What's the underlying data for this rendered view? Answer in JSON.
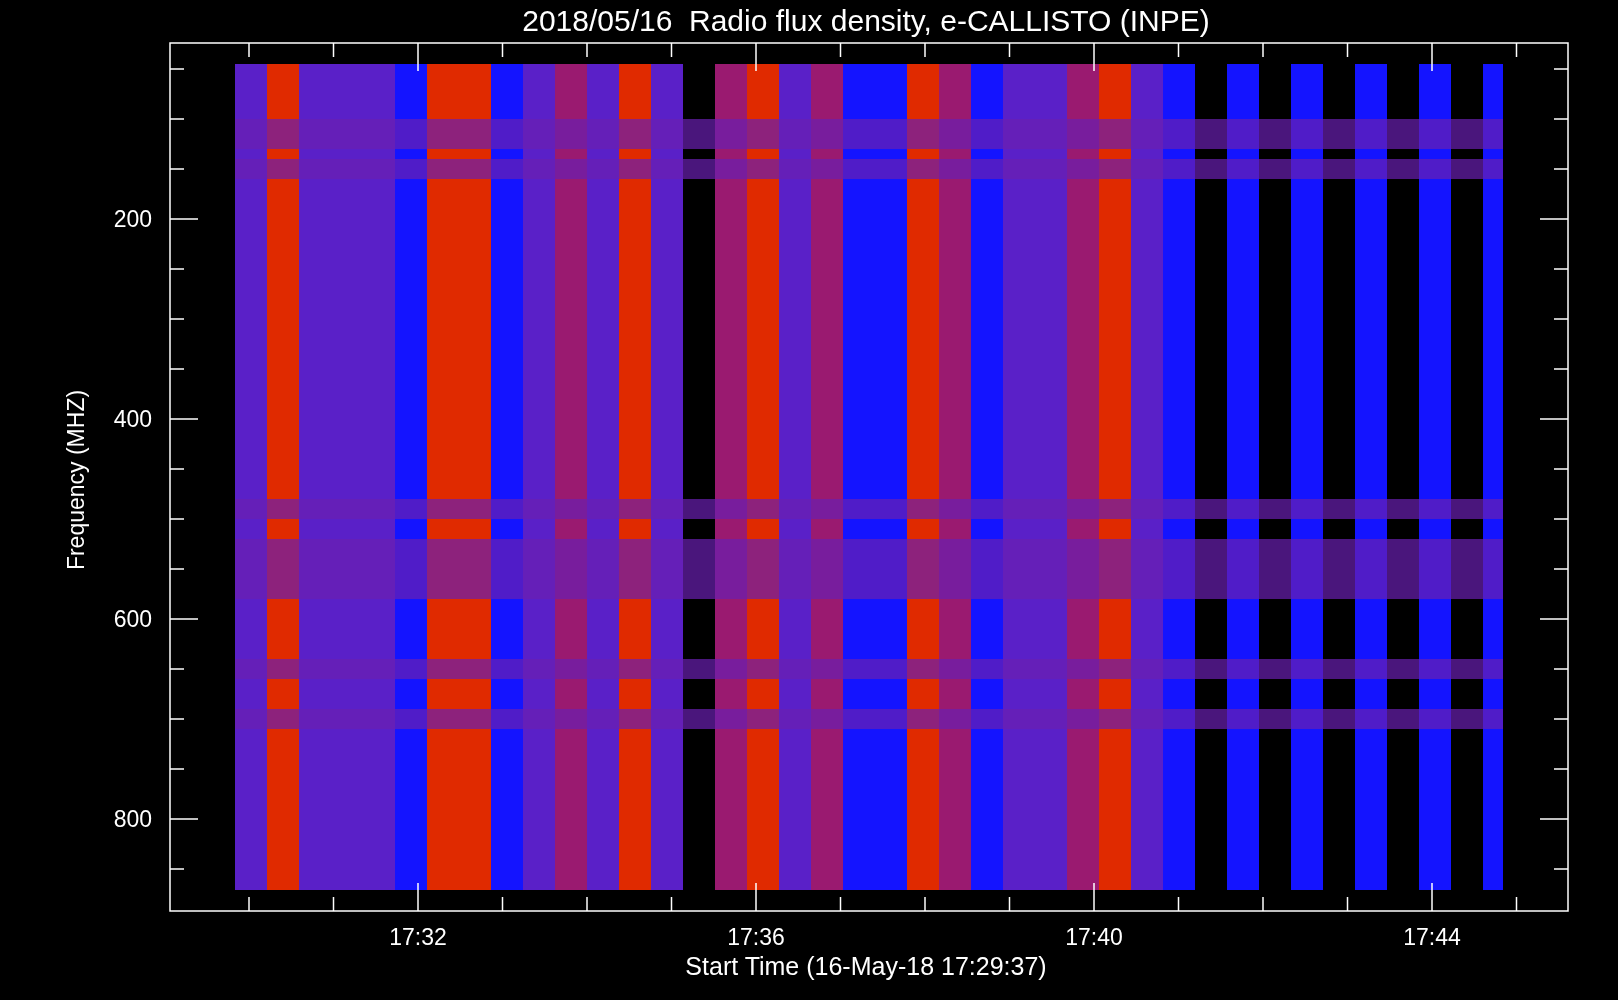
{
  "title": "2018/05/16  Radio flux density, e-CALLISTO (INPE)",
  "y_axis": {
    "label": "Frequency (MHZ)",
    "ticks": [
      "200",
      "400",
      "600",
      "800"
    ]
  },
  "x_axis": {
    "label": "Start Time (16-May-18 17:29:37)",
    "ticks": [
      "17:32",
      "17:36",
      "17:40",
      "17:44"
    ]
  }
}
